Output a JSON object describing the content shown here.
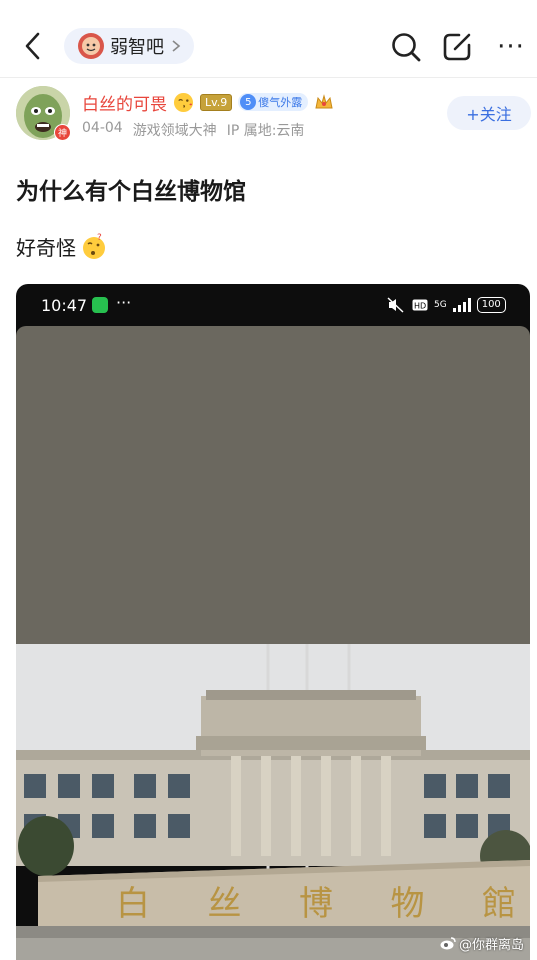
{
  "nav": {
    "forum_name": "弱智吧",
    "icons": [
      "back-arrow-icon",
      "chevron-right-icon",
      "search-icon",
      "edit-icon",
      "more-icon"
    ],
    "more_glyph": "···"
  },
  "author": {
    "username": "白丝的可畏",
    "avatar_badge": "神",
    "level": "Lv.9",
    "title_number": "5",
    "title_text": "傻气外露",
    "date": "04-04",
    "role": "游戏领域大神",
    "ip": "IP 属地:云南",
    "follow_label": "+关注"
  },
  "post": {
    "title": "为什么有个白丝博物馆",
    "body": "好奇怪"
  },
  "screenshot": {
    "time": "10:47",
    "dots": "···",
    "network": "5G",
    "battery": "100",
    "plaque_text": [
      "白",
      "丝",
      "博",
      "物",
      "館"
    ]
  },
  "watermark": "@你群离岛",
  "colors": {
    "accent_blue": "#3a6fe0",
    "username_red": "#e8463c",
    "pill_bg": "#eef2fb"
  }
}
